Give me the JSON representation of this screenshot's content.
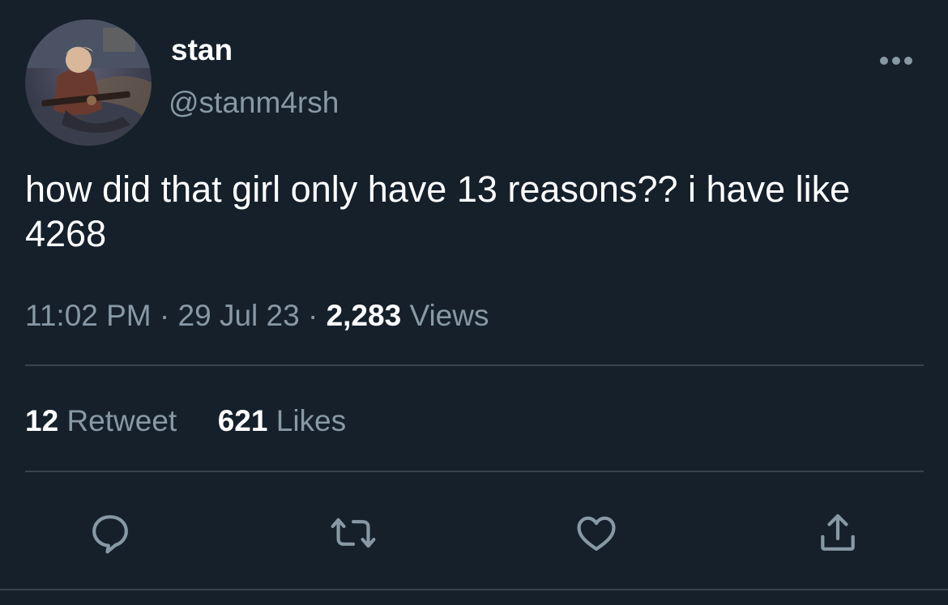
{
  "tweet": {
    "display_name": "stan",
    "handle": "@stanm4rsh",
    "text": "how did that girl only have 13 reasons?? i have like 4268",
    "time": "11:02 PM",
    "date": "29 Jul 23",
    "separator": "·",
    "views_count": "2,283",
    "views_label": "Views"
  },
  "stats": {
    "retweets_count": "12",
    "retweets_label": "Retweet",
    "likes_count": "621",
    "likes_label": "Likes"
  },
  "icons": {
    "more": "more-horizontal-icon",
    "reply": "reply-bubble-icon",
    "retweet": "retweet-arrows-icon",
    "like": "heart-icon",
    "share": "share-upload-icon"
  },
  "colors": {
    "background": "#15202b",
    "primary_text": "#ffffff",
    "secondary_text": "#8899a6",
    "divider": "#38444d"
  }
}
